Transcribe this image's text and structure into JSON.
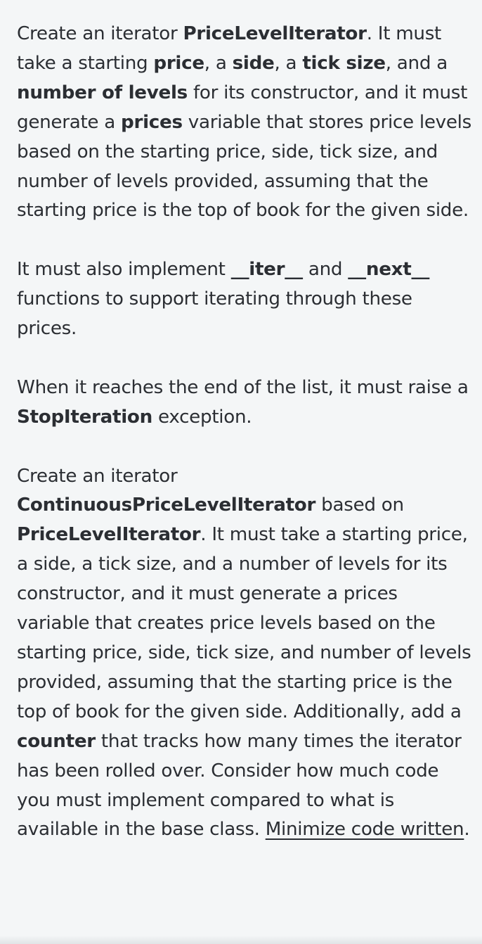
{
  "p1": {
    "t1": "Create an iterator ",
    "b1": "PriceLevelIterator",
    "t2": ". It must take a starting ",
    "b2": "price",
    "t3": ", a ",
    "b3": "side",
    "t4": ", a ",
    "b4": "tick size",
    "t5": ", and a ",
    "b5": "number of levels",
    "t6": " for its constructor, and it must generate a ",
    "b6": "prices",
    "t7": " variable that stores price levels based on the starting price, side, tick size, and number of levels provided, assuming that the starting price is the top of book for the given side."
  },
  "p2": {
    "t1": "It must also implement ",
    "b1": "__iter__",
    "t2": " and ",
    "b2": "__next__",
    "t3": " functions to support iterating through these prices."
  },
  "p3": {
    "t1": "When it reaches the end of the list, it must raise a ",
    "b1": "StopIteration",
    "t2": " exception."
  },
  "p4": {
    "t1": "Create an iterator ",
    "b1": "ContinuousPriceLevelIterator",
    "t2": " based on ",
    "b2": "PriceLevelIterator",
    "t3": ". It must take a starting price, a side, a tick size, and a number of levels for its constructor, and it must generate a prices variable that creates price levels based on the starting price, side, tick size, and number of levels provided, assuming that the starting price is the top of book for the given side. Additionally, add a ",
    "b3": "counter",
    "t4": " that tracks how many times the iterator has been rolled over. Consider how much code you must implement compared to what is available in the base class. ",
    "u1": "Minimize code written",
    "t5": "."
  }
}
